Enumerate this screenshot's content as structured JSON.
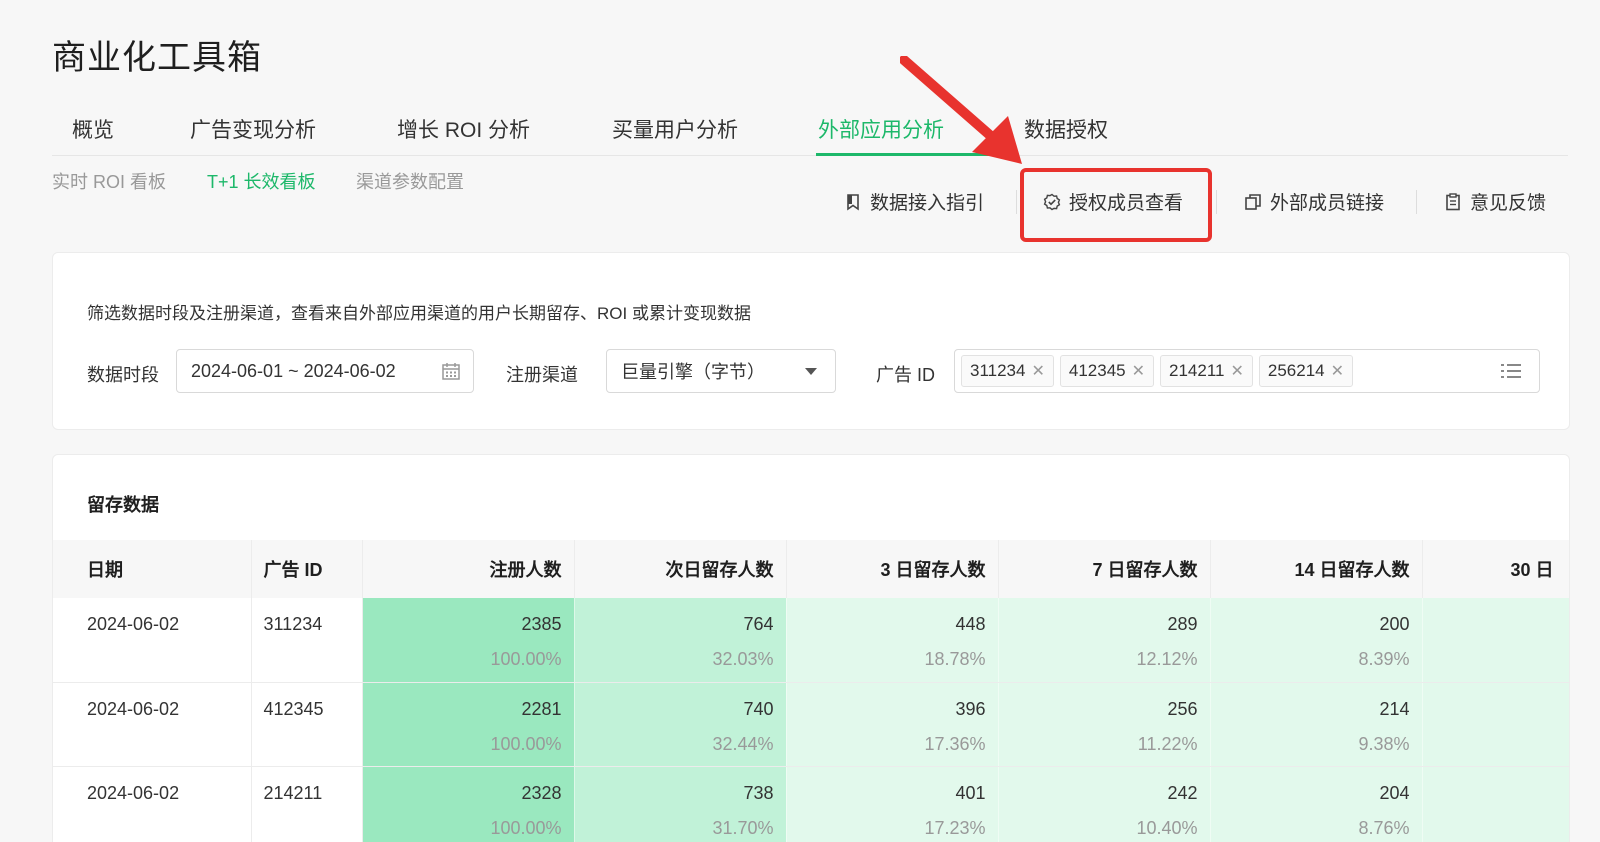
{
  "app": {
    "title": "商业化工具箱"
  },
  "main_tabs": [
    {
      "label": "概览"
    },
    {
      "label": "广告变现分析"
    },
    {
      "label": "增长 ROI 分析"
    },
    {
      "label": "买量用户分析"
    },
    {
      "label": "外部应用分析"
    },
    {
      "label": "数据授权"
    }
  ],
  "sub_tabs": [
    {
      "label": "实时 ROI 看板"
    },
    {
      "label": "T+1 长效看板"
    },
    {
      "label": "渠道参数配置"
    }
  ],
  "toolbar": {
    "guide": "数据接入指引",
    "auth_members": "授权成员查看",
    "external_link": "外部成员链接",
    "feedback": "意见反馈"
  },
  "filter": {
    "description": "筛选数据时段及注册渠道，查看来自外部应用渠道的用户长期留存、ROI 或累计变现数据",
    "date_label": "数据时段",
    "date_value": "2024-06-01 ~ 2024-06-02",
    "channel_label": "注册渠道",
    "channel_value": "巨量引擎（字节）",
    "ad_id_label": "广告 ID",
    "ad_ids": [
      "311234",
      "412345",
      "214211",
      "256214"
    ]
  },
  "retention": {
    "title": "留存数据",
    "columns": [
      "日期",
      "广告 ID",
      "注册人数",
      "次日留存人数",
      "3 日留存人数",
      "7 日留存人数",
      "14 日留存人数",
      "30 日"
    ],
    "rows": [
      {
        "date": "2024-06-02",
        "ad_id": "311234",
        "reg": "2385",
        "reg_pct": "100.00%",
        "d1": "764",
        "d1_pct": "32.03%",
        "d3": "448",
        "d3_pct": "18.78%",
        "d7": "289",
        "d7_pct": "12.12%",
        "d14": "200",
        "d14_pct": "8.39%"
      },
      {
        "date": "2024-06-02",
        "ad_id": "412345",
        "reg": "2281",
        "reg_pct": "100.00%",
        "d1": "740",
        "d1_pct": "32.44%",
        "d3": "396",
        "d3_pct": "17.36%",
        "d7": "256",
        "d7_pct": "11.22%",
        "d14": "214",
        "d14_pct": "9.38%"
      },
      {
        "date": "2024-06-02",
        "ad_id": "214211",
        "reg": "2328",
        "reg_pct": "100.00%",
        "d1": "738",
        "d1_pct": "31.70%",
        "d3": "401",
        "d3_pct": "17.23%",
        "d7": "242",
        "d7_pct": "10.40%",
        "d14": "204",
        "d14_pct": "8.76%"
      }
    ]
  },
  "colors": {
    "accent": "#1db86a",
    "highlight": "#e8332e"
  }
}
